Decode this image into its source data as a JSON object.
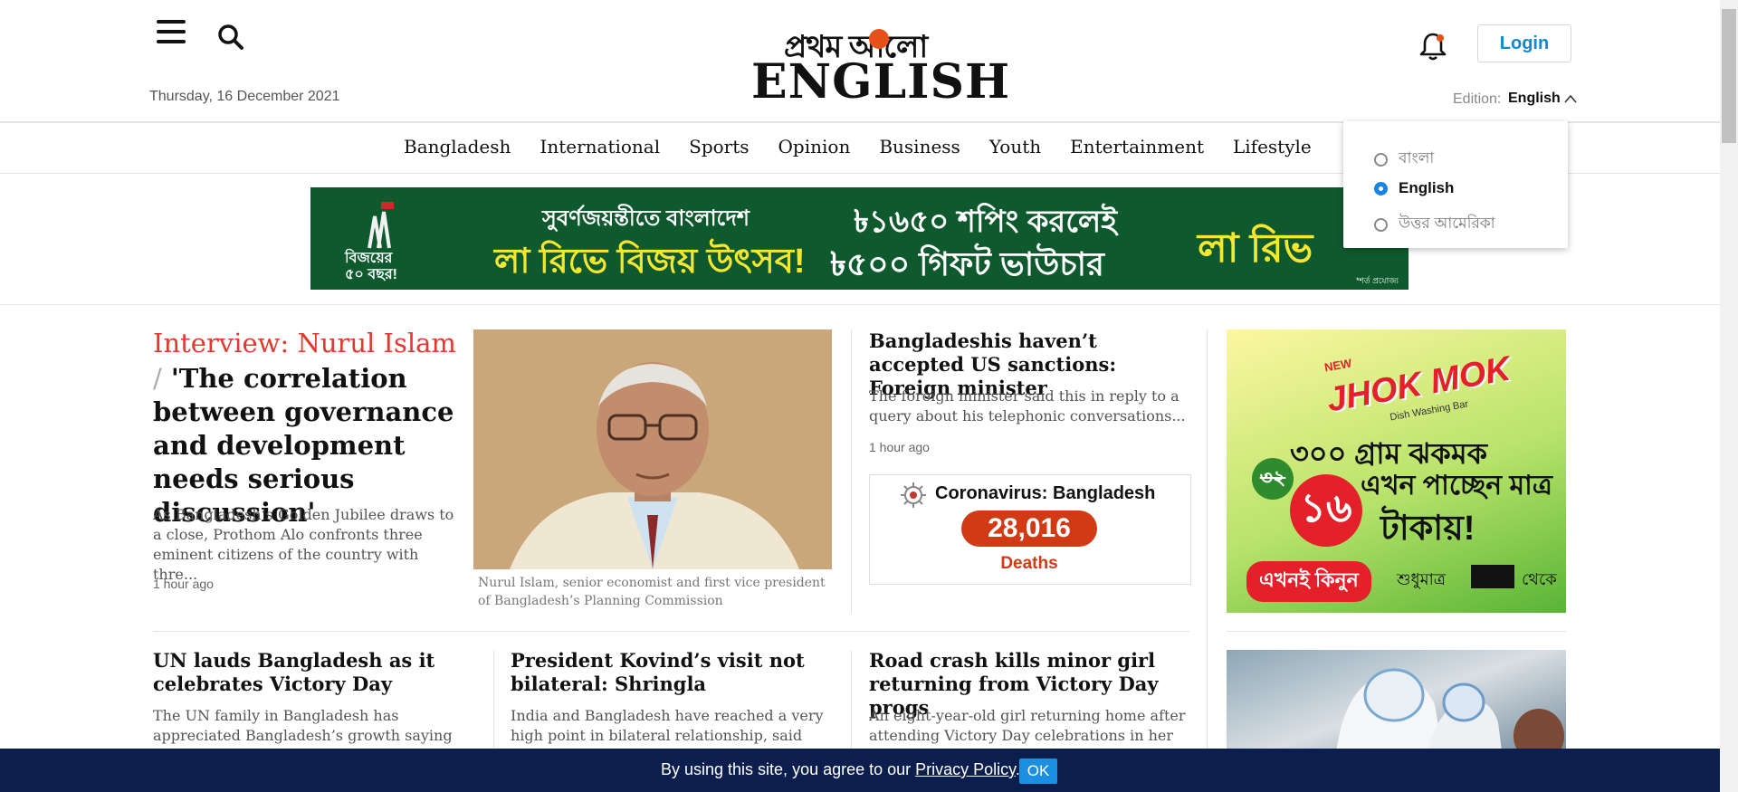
{
  "header": {
    "date": "Thursday, 16 December 2021",
    "logo_bangla": "প্রথম আলো",
    "logo_english": "ENGLISH",
    "login_label": "Login",
    "edition_label": "Edition:",
    "edition_value": "English"
  },
  "edition_dropdown": {
    "options": [
      {
        "label": "বাংলা",
        "selected": false
      },
      {
        "label": "English",
        "selected": true
      },
      {
        "label": "উত্তর আমেরিকা",
        "selected": false
      }
    ]
  },
  "nav": {
    "items": [
      "Bangladesh",
      "International",
      "Sports",
      "Opinion",
      "Business",
      "Youth",
      "Entertainment",
      "Lifestyle"
    ]
  },
  "banner": {
    "left_text": "বিজয়ের ৫০ বছর!",
    "line1": "সুবর্ণজয়ন্তীতে বাংলাদেশ",
    "line2": "লা রিভে বিজয় উৎসব!",
    "offer1": "৳১৬৫০ শপিং করলেই",
    "offer2": "৳৫০০ গিফট ভাউচার",
    "brand": "লা রিভ",
    "fine_print": "*শর্ত প্রযোজ্য"
  },
  "lead": {
    "kicker": "Interview: Nurul Islam",
    "separator": "/",
    "title": "'The correlation between governance and development needs serious discussion'",
    "summary": "As Bangladesh’s Golden Jubilee draws to a close, Prothom Alo confronts three eminent citizens of the country with thre...",
    "time": "1 hour ago",
    "caption": "Nurul Islam, senior economist and first vice president of Bangladesh’s Planning Commission"
  },
  "side_story": {
    "title": "Bangladeshis haven’t accepted US sanctions: Foreign minister",
    "summary": "The foreign minister said this in reply to a query about his telephonic conversations...",
    "time": "1 hour ago"
  },
  "covid": {
    "title": "Coronavirus: Bangladesh",
    "count": "28,016",
    "label": "Deaths"
  },
  "stories": [
    {
      "title": "UN lauds Bangladesh as it celebrates Victory Day",
      "summary": "The UN family in Bangladesh has appreciated Bangladesh’s growth saying"
    },
    {
      "title": "President Kovind’s visit not bilateral: Shringla",
      "summary": "India and Bangladesh have reached a very high point in bilateral relationship, said"
    },
    {
      "title": "Road crash kills minor girl returning from Victory Day progs",
      "summary": "An eight-year-old girl returning home after attending Victory Day celebrations in her"
    }
  ],
  "ad": {
    "new_tag": "NEW",
    "brand": "JHOK MOK",
    "brand_sub": "Dish Washing Bar",
    "line1": "৩০০ গ্রাম ঝকমক",
    "line2": "এখন পাচ্ছেন মাত্র",
    "old_price": "৩২",
    "new_price": "১৬",
    "currency": "টাকায়!",
    "cta": "এখনই কিনুন",
    "cta_suffix": "শুধুমাত্র",
    "cta_end": "থেকে"
  },
  "cookie": {
    "text_before": "By using this site, you agree to our ",
    "link": "Privacy Policy",
    "text_after": ".",
    "ok_label": "OK"
  },
  "colors": {
    "kicker_red": "#e03a2e",
    "link_blue": "#0e88d3",
    "covid_red": "#d23a16",
    "cookie_navy": "#0c1e4d"
  }
}
